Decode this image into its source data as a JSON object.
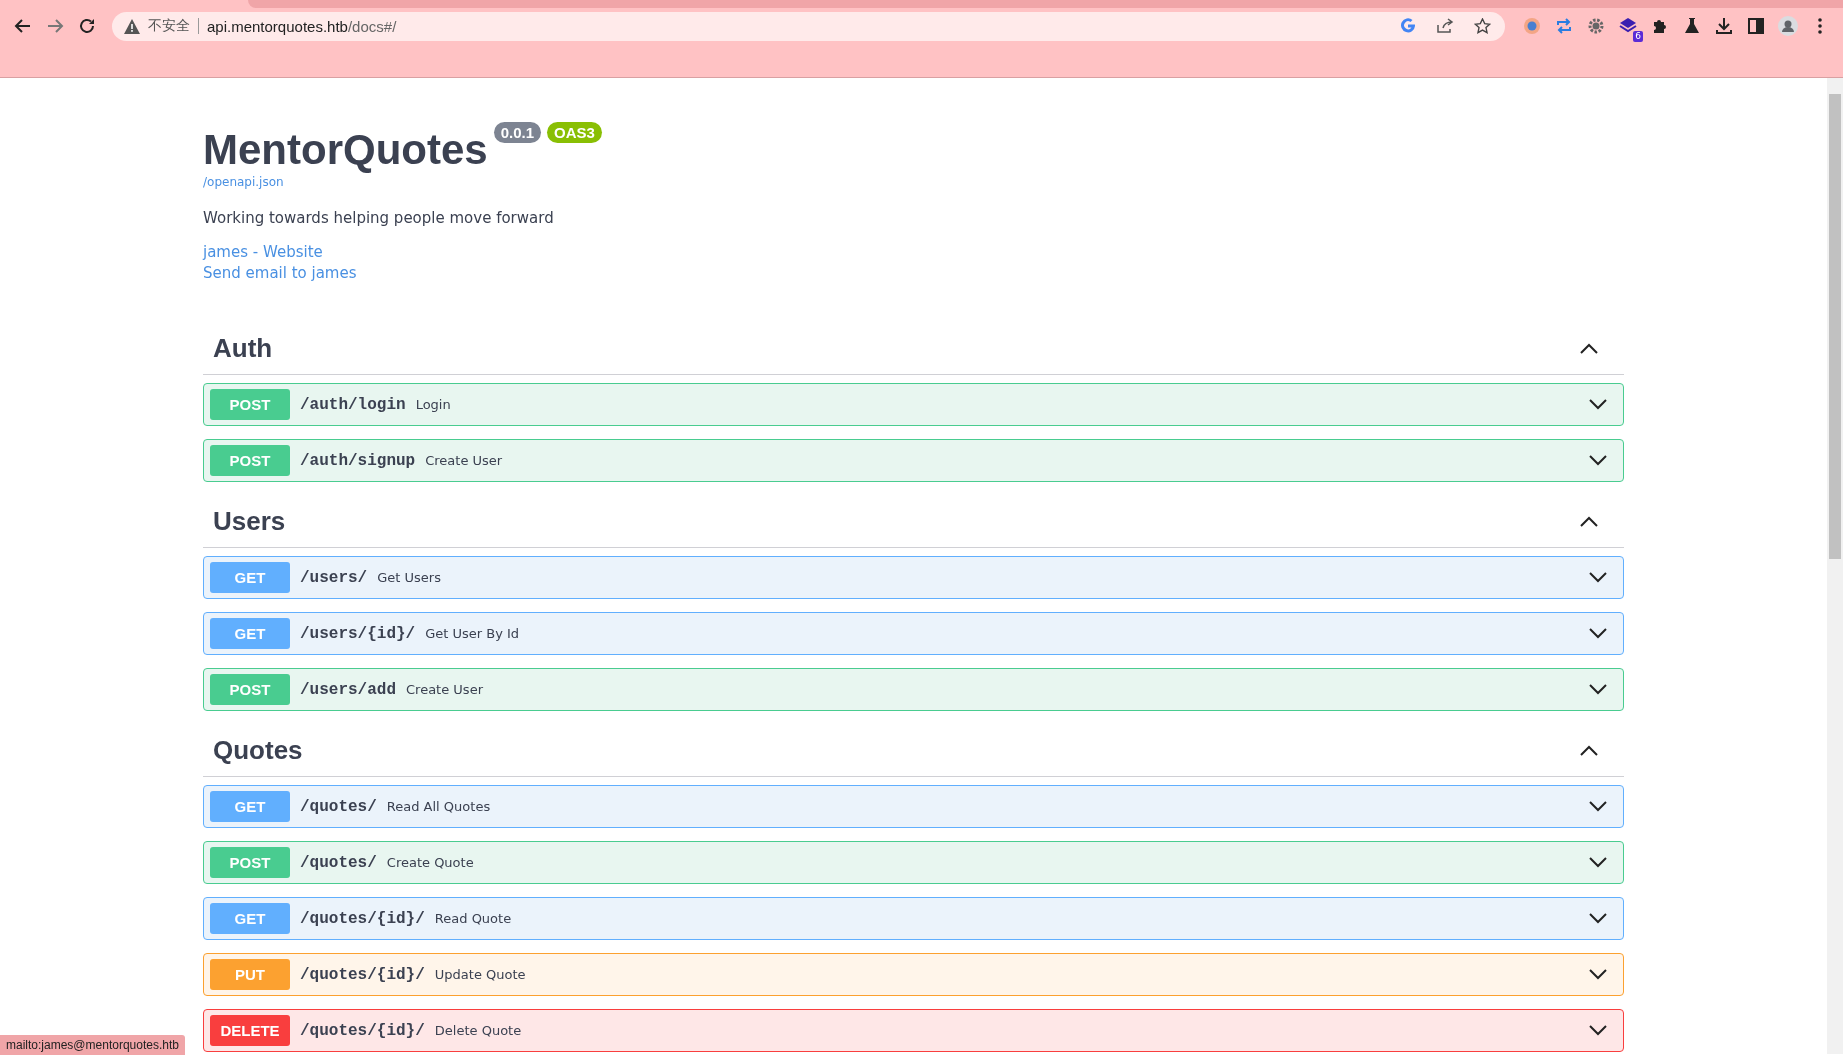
{
  "browser": {
    "security": "不安全",
    "url_host": "api.mentorquotes.htb",
    "url_path": "/docs#/",
    "extension_badge": "6",
    "status_link": "mailto:james@mentorquotes.htb"
  },
  "info": {
    "title": "MentorQuotes",
    "version": "0.0.1",
    "oas": "OAS3",
    "spec_link": "/openapi.json",
    "description": "Working towards helping people move forward",
    "links": [
      "james - Website",
      "Send email to james"
    ]
  },
  "sections": [
    {
      "name": "Auth",
      "expanded": true,
      "operations": [
        {
          "kind": "post",
          "method": "POST",
          "path": "/auth/login",
          "summary": "Login",
          "expanded": false
        },
        {
          "kind": "post",
          "method": "POST",
          "path": "/auth/signup",
          "summary": "Create User",
          "expanded": false
        }
      ]
    },
    {
      "name": "Users",
      "expanded": true,
      "operations": [
        {
          "kind": "get",
          "method": "GET",
          "path": "/users/",
          "summary": "Get Users",
          "expanded": false
        },
        {
          "kind": "get",
          "method": "GET",
          "path": "/users/{id}/",
          "summary": "Get User By Id",
          "expanded": false
        },
        {
          "kind": "post",
          "method": "POST",
          "path": "/users/add",
          "summary": "Create User",
          "expanded": false
        }
      ]
    },
    {
      "name": "Quotes",
      "expanded": true,
      "operations": [
        {
          "kind": "get",
          "method": "GET",
          "path": "/quotes/",
          "summary": "Read All Quotes",
          "expanded": false
        },
        {
          "kind": "post",
          "method": "POST",
          "path": "/quotes/",
          "summary": "Create Quote",
          "expanded": false
        },
        {
          "kind": "get",
          "method": "GET",
          "path": "/quotes/{id}/",
          "summary": "Read Quote",
          "expanded": false
        },
        {
          "kind": "put",
          "method": "PUT",
          "path": "/quotes/{id}/",
          "summary": "Update Quote",
          "expanded": false
        },
        {
          "kind": "delete",
          "method": "DELETE",
          "path": "/quotes/{id}/",
          "summary": "Delete Quote",
          "expanded": false
        }
      ]
    }
  ]
}
